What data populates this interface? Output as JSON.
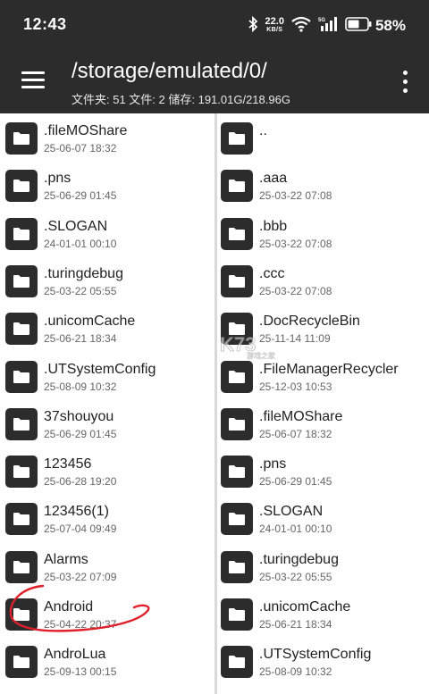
{
  "status_bar": {
    "time": "12:43",
    "net_speed_value": "22.0",
    "net_speed_unit": "KB/S",
    "battery_percent": "58%"
  },
  "toolbar": {
    "path": "/storage/emulated/0/",
    "stats": "文件夹: 51  文件: 2  储存: 191.01G/218.96G"
  },
  "left_pane": {
    "items": [
      {
        "name": ".fileMOShare",
        "date": "25-06-07 18:32"
      },
      {
        "name": ".pns",
        "date": "25-06-29 01:45"
      },
      {
        "name": ".SLOGAN",
        "date": "24-01-01 00:10"
      },
      {
        "name": ".turingdebug",
        "date": "25-03-22 05:55"
      },
      {
        "name": ".unicomCache",
        "date": "25-06-21 18:34"
      },
      {
        "name": ".UTSystemConfig",
        "date": "25-08-09 10:32"
      },
      {
        "name": "37shouyou",
        "date": "25-06-29 01:45"
      },
      {
        "name": "123456",
        "date": "25-06-28 19:20"
      },
      {
        "name": "123456(1)",
        "date": "25-07-04 09:49"
      },
      {
        "name": "Alarms",
        "date": "25-03-22 07:09"
      },
      {
        "name": "Android",
        "date": "25-04-22 20:37"
      },
      {
        "name": "AndroLua",
        "date": "25-09-13 00:15"
      }
    ]
  },
  "right_pane": {
    "items": [
      {
        "name": "..",
        "date": ""
      },
      {
        "name": ".aaa",
        "date": "25-03-22 07:08"
      },
      {
        "name": ".bbb",
        "date": "25-03-22 07:08"
      },
      {
        "name": ".ccc",
        "date": "25-03-22 07:08"
      },
      {
        "name": ".DocRecycleBin",
        "date": "25-11-14 11:09"
      },
      {
        "name": ".FileManagerRecycler",
        "date": "25-12-03 10:53"
      },
      {
        "name": ".fileMOShare",
        "date": "25-06-07 18:32"
      },
      {
        "name": ".pns",
        "date": "25-06-29 01:45"
      },
      {
        "name": ".SLOGAN",
        "date": "24-01-01 00:10"
      },
      {
        "name": ".turingdebug",
        "date": "25-03-22 05:55"
      },
      {
        "name": ".unicomCache",
        "date": "25-06-21 18:34"
      },
      {
        "name": ".UTSystemConfig",
        "date": "25-08-09 10:32"
      }
    ]
  },
  "watermark": {
    "logo": "K73",
    "text": "游戏之家"
  },
  "colors": {
    "toolbar_bg": "#2c2c2c",
    "icon_bg": "#2c2c2c",
    "annotation": "#e0202a"
  }
}
